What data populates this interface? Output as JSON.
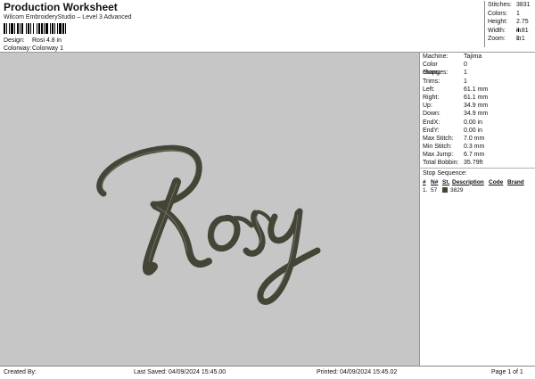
{
  "header": {
    "title": "Production Worksheet",
    "subtitle": "Wilcom EmbroideryStudio – Level 3 Advanced",
    "design_label": "Design:",
    "design_value": "Rosi 4.8 in",
    "colorway_label": "Colorway:",
    "colorway_value": "Colorway 1"
  },
  "summary": {
    "stitches_label": "Stitches:",
    "stitches": "3831",
    "colors_label": "Colors:",
    "colors": "1",
    "height_label": "Height:",
    "height": "2.75 in",
    "width_label": "Width:",
    "width": "4.81 in",
    "zoom_label": "Zoom:",
    "zoom": "1:1"
  },
  "design_art": {
    "text": "Rosy",
    "thread_color": "#444437",
    "background_color": "#c6c6c6"
  },
  "details": [
    {
      "label": "Machine:",
      "value": "Tajima"
    },
    {
      "label": "Color changes:",
      "value": "0"
    },
    {
      "label": "Stops:",
      "value": "1"
    },
    {
      "label": "Trims:",
      "value": "1"
    },
    {
      "label": "Left:",
      "value": "61.1 mm"
    },
    {
      "label": "Right:",
      "value": "61.1 mm"
    },
    {
      "label": "Up:",
      "value": "34.9 mm"
    },
    {
      "label": "Down:",
      "value": "34.9 mm"
    },
    {
      "label": "EndX:",
      "value": "0.00 in"
    },
    {
      "label": "EndY:",
      "value": "0.00 in"
    },
    {
      "label": "Max Stitch:",
      "value": "7.0 mm"
    },
    {
      "label": "Min Stitch:",
      "value": "0.3 mm"
    },
    {
      "label": "Max Jump:",
      "value": "6.7 mm"
    },
    {
      "label": "Total Bobbin:",
      "value": "35.79ft"
    }
  ],
  "stop_sequence": {
    "heading": "Stop Sequence:",
    "columns": [
      "#",
      "N#",
      "St.",
      "Description",
      "Code",
      "Brand"
    ],
    "rows": [
      {
        "num": "1.",
        "n": "57",
        "stitches": "3829",
        "color": "#444437"
      }
    ]
  },
  "footer": {
    "created": "Created By:",
    "saved": "Last Saved: 04/09/2024 15:45.00",
    "printed": "Printed: 04/09/2024 15:45.02",
    "page": "Page 1 of 1"
  }
}
